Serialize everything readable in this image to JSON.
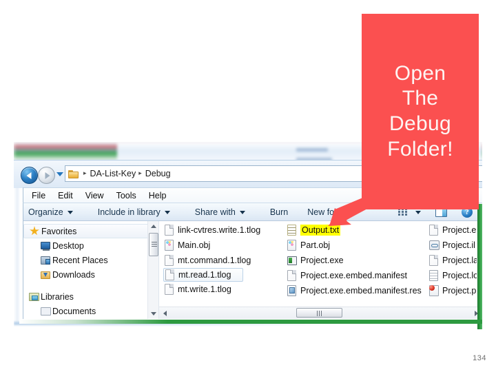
{
  "callout": {
    "text": "Open The Debug Folder!",
    "lines": [
      "Open",
      "The",
      "Debug",
      "Folder!"
    ],
    "bg_color": "#fb5050",
    "text_color": "#fdf4f2",
    "arrow": "red-arrow-down-left"
  },
  "slide": {
    "page_number": "134",
    "background": "#ffffff",
    "accent_green": "#2d9a40"
  },
  "explorer": {
    "address_bar": {
      "folder_icon": "folder-icon",
      "crumbs": [
        "DA-List-Key",
        "Debug"
      ],
      "separator": "▶",
      "back_label": "Back",
      "forward_label": "Forward",
      "recent_label": "Recent pages"
    },
    "menu": [
      "File",
      "Edit",
      "View",
      "Tools",
      "Help"
    ],
    "toolbar": {
      "items": [
        {
          "label": "Organize",
          "has_caret": true
        },
        {
          "label": "Include in library",
          "has_caret": true
        },
        {
          "label": "Share with",
          "has_caret": true
        },
        {
          "label": "Burn",
          "has_caret": false
        },
        {
          "label": "New folder",
          "has_caret": false
        }
      ],
      "view_icon": "view-options-icon",
      "view_caret": "chevron-down-icon",
      "preview_pane_icon": "preview-pane-icon",
      "help_icon": "help-icon",
      "help_glyph": "?"
    },
    "nav_pane": {
      "groups": [
        {
          "header": {
            "label": "Favorites",
            "icon": "star-icon",
            "selected": true
          },
          "items": [
            {
              "label": "Desktop",
              "icon": "desktop-icon"
            },
            {
              "label": "Recent Places",
              "icon": "recent-places-icon"
            },
            {
              "label": "Downloads",
              "icon": "downloads-icon"
            }
          ]
        },
        {
          "header": {
            "label": "Libraries",
            "icon": "libraries-icon",
            "selected": false
          },
          "items": [
            {
              "label": "Documents",
              "icon": "documents-icon"
            }
          ]
        }
      ]
    },
    "file_list": {
      "columns": [
        [
          {
            "name": "link-cvtres.write.1.tlog",
            "icon": "generic-file-icon",
            "selected": false,
            "highlighted": false
          },
          {
            "name": "Main.obj",
            "icon": "object-file-icon",
            "selected": false,
            "highlighted": false
          },
          {
            "name": "mt.command.1.tlog",
            "icon": "generic-file-icon",
            "selected": false,
            "highlighted": false
          },
          {
            "name": "mt.read.1.tlog",
            "icon": "generic-file-icon",
            "selected": true,
            "highlighted": false
          },
          {
            "name": "mt.write.1.tlog",
            "icon": "generic-file-icon",
            "selected": false,
            "highlighted": false
          }
        ],
        [
          {
            "name": "Output.txt",
            "icon": "text-file-icon",
            "selected": false,
            "highlighted": true
          },
          {
            "name": "Part.obj",
            "icon": "object-file-icon",
            "selected": false,
            "highlighted": false
          },
          {
            "name": "Project.exe",
            "icon": "executable-icon",
            "selected": false,
            "highlighted": false
          },
          {
            "name": "Project.exe.embed.manifest",
            "icon": "generic-file-icon",
            "selected": false,
            "highlighted": false
          },
          {
            "name": "Project.exe.embed.manifest.res",
            "icon": "resource-file-icon",
            "selected": false,
            "highlighted": false
          }
        ],
        [
          {
            "name": "Project.e",
            "icon": "generic-file-icon",
            "selected": false,
            "highlighted": false
          },
          {
            "name": "Project.il",
            "icon": "link-file-icon",
            "selected": false,
            "highlighted": false
          },
          {
            "name": "Project.la",
            "icon": "generic-file-icon",
            "selected": false,
            "highlighted": false
          },
          {
            "name": "Project.lo",
            "icon": "log-file-icon",
            "selected": false,
            "highlighted": false
          },
          {
            "name": "Project.p",
            "icon": "publish-file-icon",
            "selected": false,
            "highlighted": false
          }
        ]
      ]
    },
    "scrollbars": {
      "nav_up": "scroll-up-arrow",
      "nav_down": "scroll-down-arrow",
      "file_left": "scroll-left-arrow",
      "file_right": "scroll-right-arrow"
    }
  }
}
